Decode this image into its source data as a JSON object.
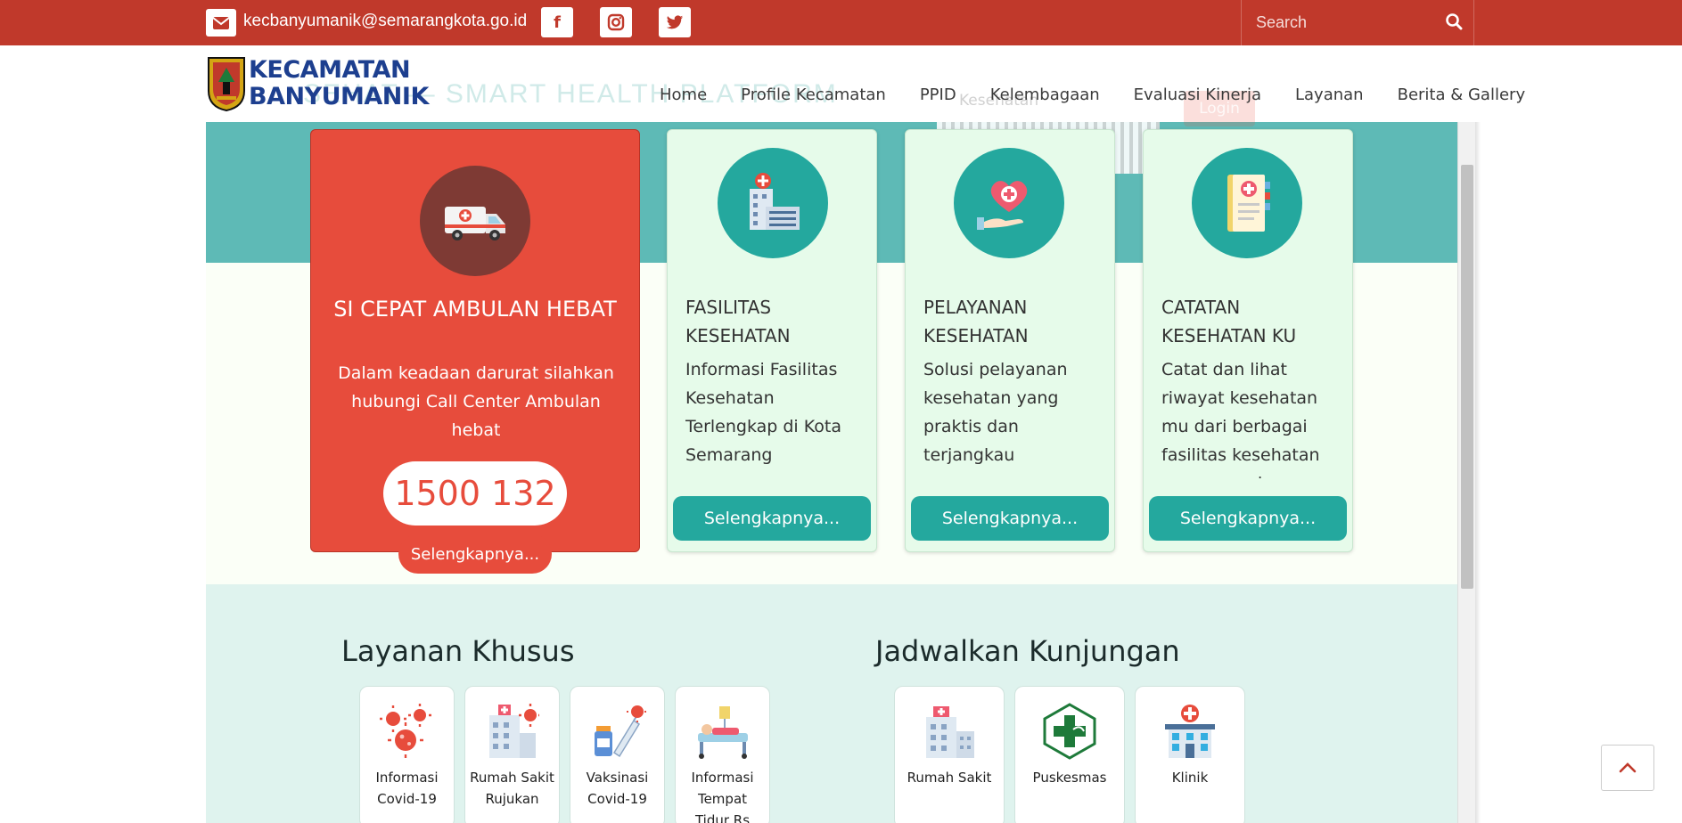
{
  "topbar": {
    "email": "kecbanyumanik@semarangkota.go.id",
    "social": [
      "facebook-icon",
      "instagram-icon",
      "twitter-icon"
    ],
    "search_placeholder": "Search"
  },
  "header": {
    "logo_line1": "KECAMATAN",
    "logo_line2": "BANYUMANIK",
    "ghost_banner": "SEHAT — SMART HEALTH PLATFORM",
    "ghost_small": "Kesehatan",
    "ghost_login": "Login",
    "nav": [
      "Home",
      "Profile Kecamatan",
      "PPID",
      "Kelembagaan",
      "Evaluasi Kinerja",
      "Layanan",
      "Berita & Gallery"
    ]
  },
  "cards": {
    "ambulance": {
      "title": "SI CEPAT AMBULAN HEBAT",
      "description": "Dalam keadaan darurat silahkan hubungi Call Center Ambulan hebat",
      "phone": "1500 132",
      "button": "Selengkapnya..."
    },
    "services": [
      {
        "title": "FASILITAS KESEHATAN",
        "description": "Informasi Fasilitas Kesehatan Terlengkap di Kota Semarang",
        "button": "Selengkapnya...",
        "icon": "hospital-building-icon"
      },
      {
        "title": "PELAYANAN KESEHATAN",
        "description": "Solusi pelayanan kesehatan yang praktis dan terjangkau",
        "button": "Selengkapnya...",
        "icon": "heart-hand-icon"
      },
      {
        "title": "CATATAN KESEHATAN KU",
        "description": "Catat dan lihat riwayat kesehatan mu dari berbagai fasilitas kesehatan yang pernah",
        "button": "Selengkapnya...",
        "icon": "medical-notebook-icon"
      }
    ]
  },
  "layanan_khusus": {
    "title": "Layanan Khusus",
    "items": [
      "Informasi Covid-19",
      "Rumah Sakit Rujukan",
      "Vaksinasi Covid-19",
      "Informasi Tempat Tidur Rs"
    ]
  },
  "jadwalkan": {
    "title": "Jadwalkan Kunjungan",
    "items": [
      "Rumah Sakit",
      "Puskesmas",
      "Klinik"
    ]
  },
  "colors": {
    "topbar": "#c0392b",
    "accent_red": "#e74c3c",
    "teal": "#24a89e",
    "card_green": "#e6fbea"
  }
}
